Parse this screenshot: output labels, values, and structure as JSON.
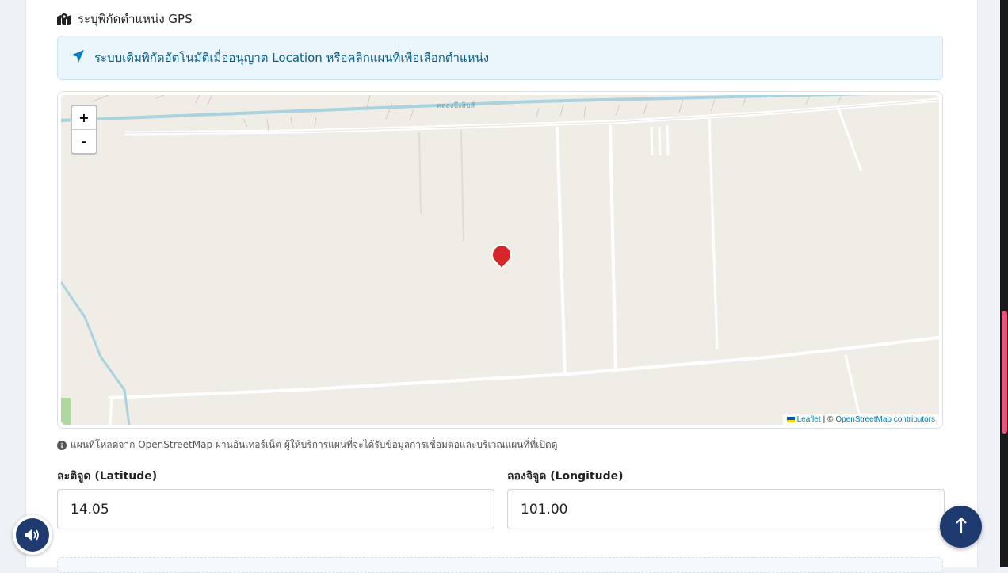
{
  "section": {
    "title": "ระบุพิกัดตำแหน่ง GPS",
    "icon": "map-location-icon"
  },
  "alert": {
    "text": "ระบบเติมพิกัดอัตโนมัติเมื่ออนุญาต Location หรือคลิกแผนที่เพื่อเลือกตำแหน่ง",
    "icon": "location-arrow-icon"
  },
  "map": {
    "zoom_in": "+",
    "zoom_out": "-",
    "canal_label": "คลองบึงสิบสี่",
    "attribution": {
      "leaflet": "Leaflet",
      "separator": "| ©",
      "osm": "OpenStreetMap contributors"
    },
    "marker_color": "#d7262a"
  },
  "note": {
    "text": "แผนที่โหลดจาก OpenStreetMap ผ่านอินเทอร์เน็ต ผู้ให้บริการแผนที่จะได้รับข้อมูลการเชื่อมต่อและบริเวณแผนที่ที่เปิดดู"
  },
  "latitude": {
    "label": "ละติจูด (Latitude)",
    "value": "14.05"
  },
  "longitude": {
    "label": "ลองจิจูด (Longitude)",
    "value": "101.00"
  },
  "colors": {
    "accent": "#1f3a6e",
    "alert_bg": "#eaf6fc",
    "alert_text": "#0a5d86",
    "scroll_thumb": "#e8537a"
  }
}
